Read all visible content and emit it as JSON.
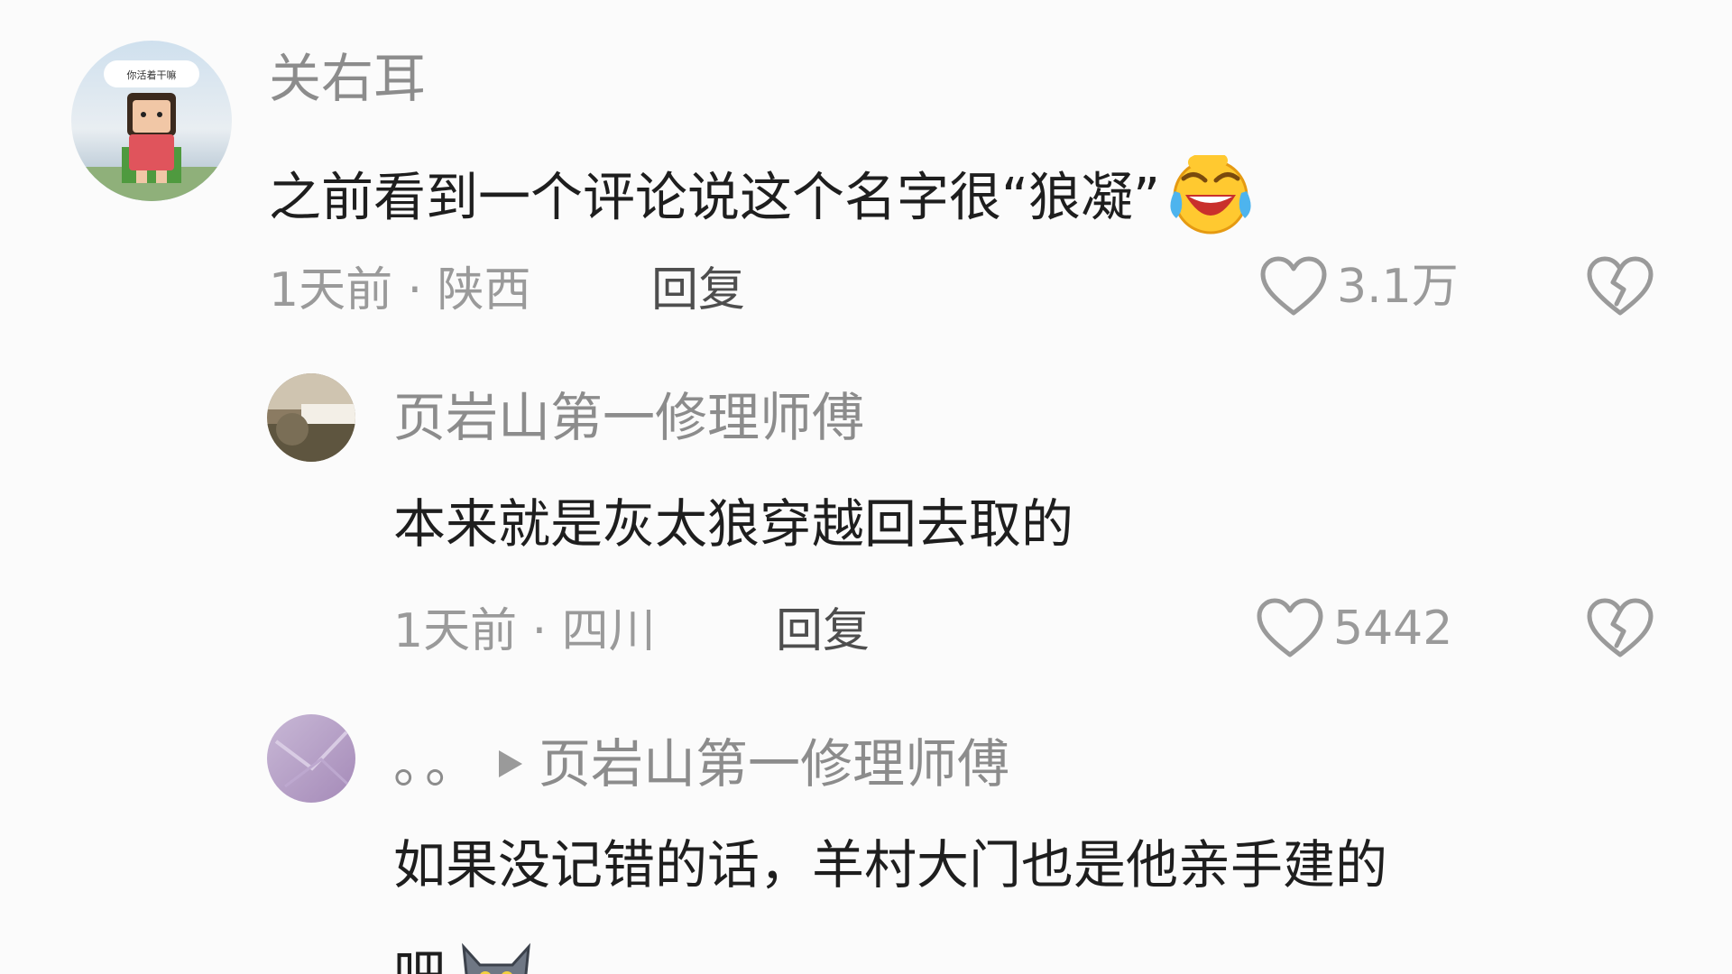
{
  "comments": [
    {
      "username": "关右耳",
      "text": "之前看到一个评论说这个名字很“狼凝”",
      "emoji": "laughing-crying-emoji",
      "time_location": "1天前 · 陕西",
      "reply_label": "回复",
      "like_count": "3.1万",
      "avatar_caption": "你活着干嘛"
    },
    {
      "username": "页岩山第一修理师傅",
      "text": "本来就是灰太狼穿越回去取的",
      "time_location": "1天前 · 四川",
      "reply_label": "回复",
      "like_count": "5442"
    },
    {
      "username": "。。",
      "reply_to": "页岩山第一修理师傅",
      "text_line1": "如果没记错的话，羊村大门也是他亲手建的",
      "text_line2": "吧",
      "emoji": "grey-wolf-emoji"
    }
  ],
  "colors": {
    "background": "#fbfbfb",
    "username": "#8c8c8c",
    "text": "#1e1e1e",
    "meta": "#9a9a9a",
    "reply": "#4e4e4e"
  },
  "icons": {
    "like": "heart-outline-icon",
    "dislike": "broken-heart-icon",
    "reply_arrow": "play-triangle-icon"
  }
}
